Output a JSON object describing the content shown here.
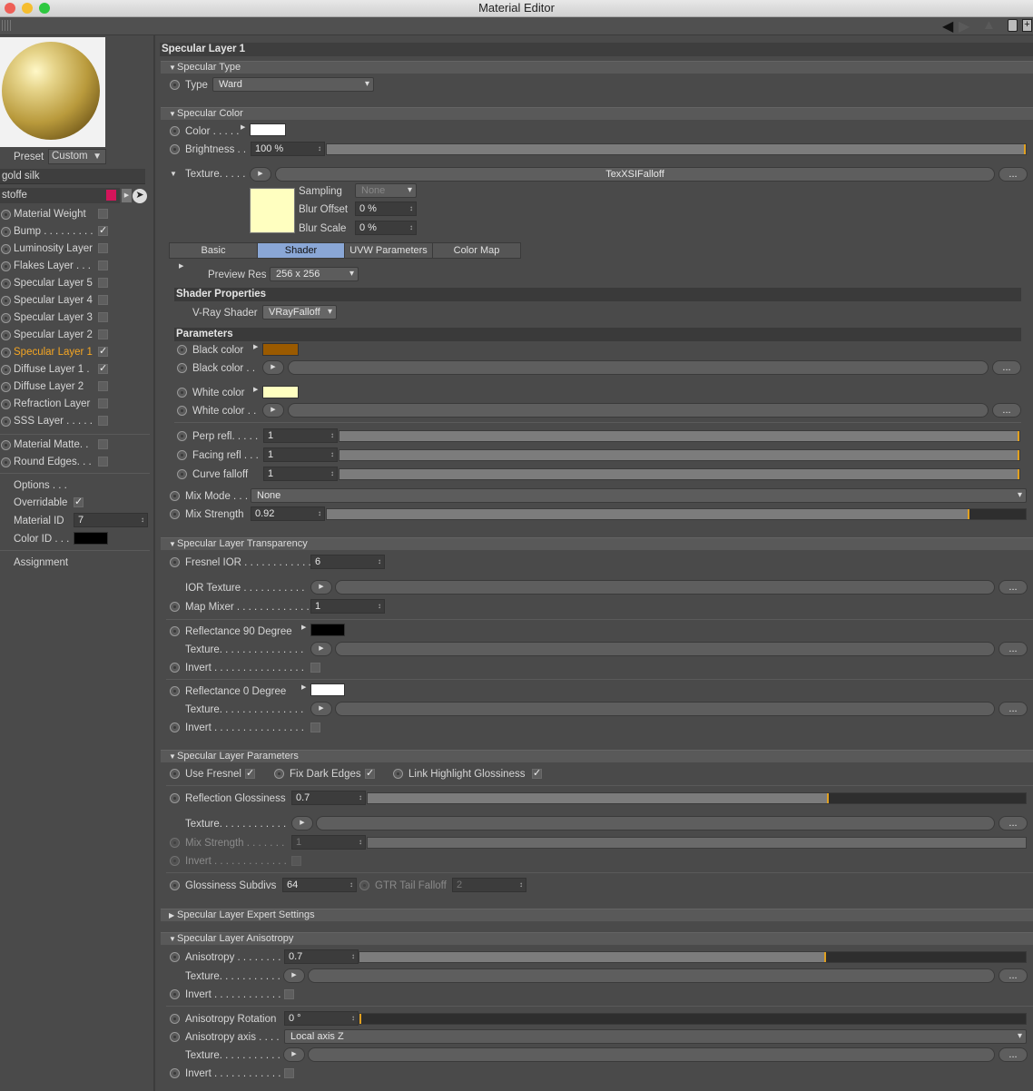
{
  "window": {
    "title": "Material Editor"
  },
  "left": {
    "preset_label": "Preset",
    "preset_value": "Custom",
    "material_name": "gold silk",
    "layer_name": "stoffe",
    "channels": [
      {
        "label": "Material Weight",
        "checked": false
      },
      {
        "label": "Bump . . . . . . . . .",
        "checked": true
      },
      {
        "label": "Luminosity Layer",
        "checked": false
      },
      {
        "label": "Flakes Layer . . .",
        "checked": false
      },
      {
        "label": "Specular Layer 5",
        "checked": false
      },
      {
        "label": "Specular Layer 4",
        "checked": false
      },
      {
        "label": "Specular Layer 3",
        "checked": false
      },
      {
        "label": "Specular Layer 2",
        "checked": false
      },
      {
        "label": "Specular Layer 1",
        "checked": true,
        "active": true
      },
      {
        "label": "Diffuse Layer 1 .",
        "checked": true
      },
      {
        "label": "Diffuse Layer 2",
        "checked": false
      },
      {
        "label": "Refraction Layer",
        "checked": false
      },
      {
        "label": "SSS Layer . . . . .",
        "checked": false
      }
    ],
    "extras": [
      {
        "label": "Material Matte. .",
        "checked": false
      },
      {
        "label": "Round Edges. . .",
        "checked": false
      }
    ],
    "options_label": "Options . . .",
    "overridable_label": "Overridable",
    "material_id_label": "Material ID",
    "material_id_value": "7",
    "color_id_label": "Color ID . . .",
    "assignment_label": "Assignment"
  },
  "panel": {
    "title": "Specular Layer 1",
    "spec_type": {
      "header": "Specular Type",
      "type_label": "Type",
      "type_value": "Ward"
    },
    "spec_color": {
      "header": "Specular Color",
      "color_label": "Color . . . . .",
      "brightness_label": "Brightness . .",
      "brightness_value": "100 %",
      "brightness_fraction": 1.0,
      "texture_label": "Texture. . . . .",
      "texture_name": "TexXSIFalloff",
      "sampling_label": "Sampling",
      "sampling_value": "None",
      "blur_offset_label": "Blur Offset",
      "blur_offset_value": "0 %",
      "blur_scale_label": "Blur Scale",
      "blur_scale_value": "0 %",
      "tabs": [
        "Basic",
        "Shader",
        "UVW Parameters",
        "Color Map"
      ],
      "preview_res_label": "Preview Res",
      "preview_res_value": "256 x 256",
      "shader_props_header": "Shader Properties",
      "vray_shader_label": "V-Ray Shader",
      "vray_shader_value": "VRayFalloff",
      "params_header": "Parameters",
      "black_color_label": "Black color",
      "black_color_tex_label": "Black color . .",
      "white_color_label": "White color",
      "white_color_tex_label": "White color . .",
      "perp_label": "Perp refl. . . . .",
      "perp_value": "1",
      "facing_label": "Facing refl . . .",
      "facing_value": "1",
      "curve_label": "Curve falloff",
      "curve_value": "1",
      "mix_mode_label": "Mix Mode . . .",
      "mix_mode_value": "None",
      "mix_strength_label": "Mix Strength",
      "mix_strength_value": "0.92",
      "mix_strength_fraction": 0.92,
      "dots_button": "...",
      "colors": {
        "white": "#ffffff",
        "black_swatch": "#9a5a00",
        "white_swatch": "#ffffc0",
        "preview": "#ffffc0"
      }
    },
    "transparency": {
      "header": "Specular Layer Transparency",
      "fresnel_label": "Fresnel IOR . . . . . . . . . . . .",
      "fresnel_value": "6",
      "ior_tex_label": "IOR Texture . . . . . . . . . . .",
      "map_mixer_label": "Map Mixer . . . . . . . . . . . . .",
      "map_mixer_value": "1",
      "refl90_label": "Reflectance 90 Degree",
      "texture_label": "Texture. . . . . . . . . . . . . . .",
      "invert_label": "Invert . . . . . . . . . . . . . . . .",
      "refl0_label": "Reflectance   0 Degree"
    },
    "params": {
      "header": "Specular Layer Parameters",
      "use_fresnel_label": "Use Fresnel",
      "fix_dark_label": "Fix Dark Edges",
      "link_gloss_label": "Link Highlight Glossiness",
      "refl_gloss_label": "Reflection Glossiness",
      "refl_gloss_value": "0.7",
      "refl_gloss_fraction": 0.7,
      "texture_label": "Texture. . . . . . . . . . . .",
      "mix_strength_label": "Mix Strength . . . . . . .",
      "mix_strength_value": "1",
      "invert_label": "Invert . . . . . . . . . . . . .",
      "gloss_subdivs_label": "Glossiness Subdivs",
      "gloss_subdivs_value": "64",
      "gtr_label": "GTR Tail Falloff",
      "gtr_value": "2"
    },
    "expert": {
      "header": "Specular Layer Expert Settings"
    },
    "aniso": {
      "header": "Specular Layer Anisotropy",
      "anisotropy_label": "Anisotropy . . . . . . . .",
      "anisotropy_value": "0.7",
      "anisotropy_fraction": 0.7,
      "texture_label": "Texture. . . . . . . . . . . .",
      "invert_label": "Invert . . . . . . . . . . . . .",
      "rotation_label": "Anisotropy Rotation",
      "rotation_value": "0 °",
      "axis_label": "Anisotropy axis . . . .",
      "axis_value": "Local axis Z"
    }
  }
}
